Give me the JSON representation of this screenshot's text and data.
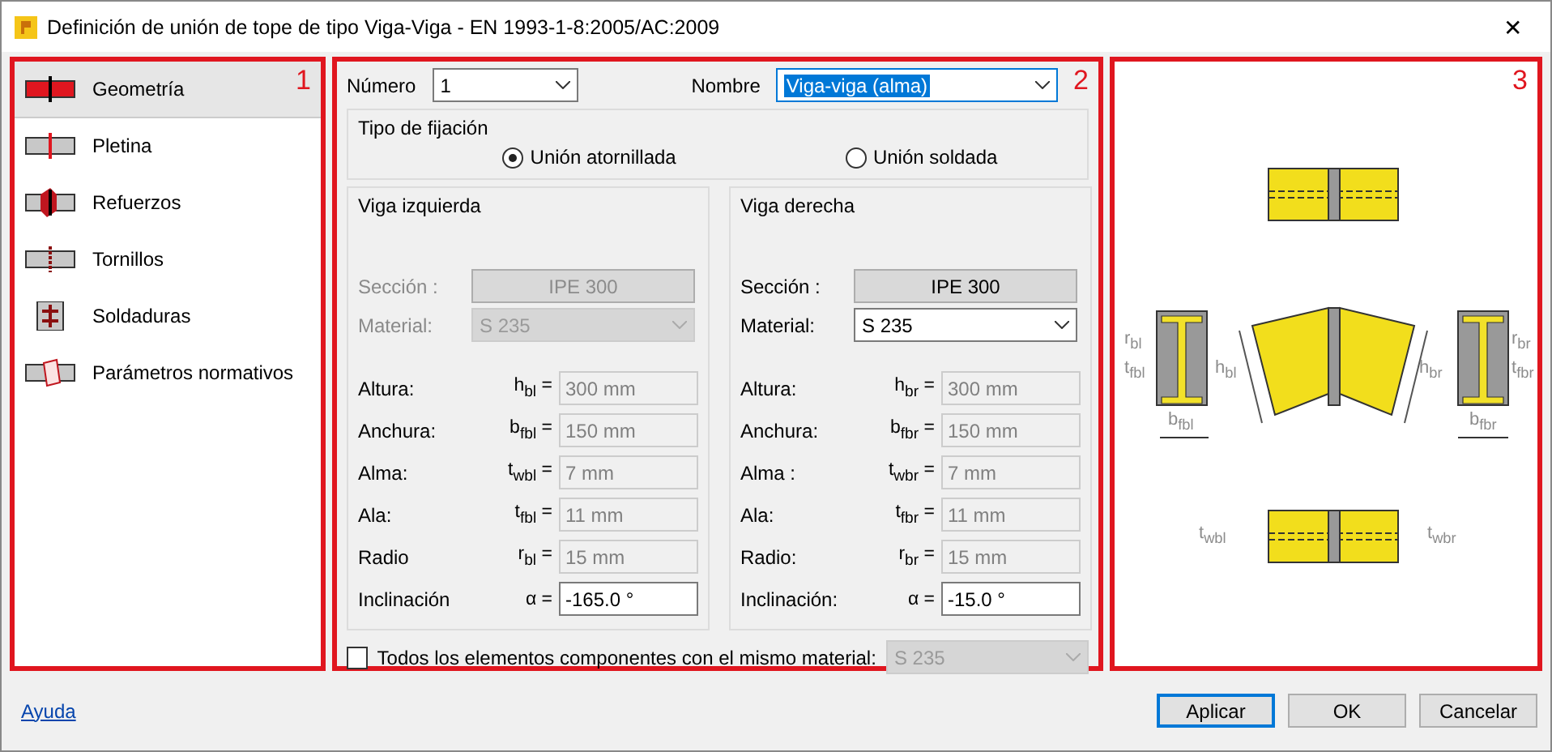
{
  "window": {
    "title": "Definición de unión de tope de tipo Viga-Viga - EN 1993-1-8:2005/AC:2009",
    "close": "✕"
  },
  "callouts": [
    "1",
    "2",
    "3"
  ],
  "sidebar": {
    "items": [
      {
        "label": "Geometría",
        "selected": true,
        "kind": "geometry"
      },
      {
        "label": "Pletina",
        "selected": false,
        "kind": "plate"
      },
      {
        "label": "Refuerzos",
        "selected": false,
        "kind": "stiffener"
      },
      {
        "label": "Tornillos",
        "selected": false,
        "kind": "bolts"
      },
      {
        "label": "Soldaduras",
        "selected": false,
        "kind": "welds"
      },
      {
        "label": "Parámetros normativos",
        "selected": false,
        "kind": "params"
      }
    ]
  },
  "header": {
    "number_label": "Número",
    "number_value": "1",
    "name_label": "Nombre",
    "name_value": "Viga-viga (alma)"
  },
  "fixing": {
    "title": "Tipo de fijación",
    "options": [
      {
        "label": "Unión atornillada",
        "selected": true
      },
      {
        "label": "Unión soldada",
        "selected": false
      }
    ]
  },
  "beams": [
    {
      "title": "Viga izquierda",
      "section_label": "Sección :",
      "section_value": "IPE 300",
      "material_label": "Material:",
      "material_value": "S 235",
      "disabled": true,
      "rows": [
        {
          "label": "Altura:",
          "symbol": "h$_{bl}$ =",
          "value": "300 mm",
          "disabled": true
        },
        {
          "label": "Anchura:",
          "symbol": "b$_{fbl}$ =",
          "value": "150 mm",
          "disabled": true
        },
        {
          "label": "Alma:",
          "symbol": "t$_{wbl}$ =",
          "value": "7 mm",
          "disabled": true
        },
        {
          "label": "Ala:",
          "symbol": "t$_{fbl}$ =",
          "value": "11 mm",
          "disabled": true
        },
        {
          "label": "Radio",
          "symbol": "r$_{bl}$ =",
          "value": "15 mm",
          "disabled": true
        },
        {
          "label": "Inclinación",
          "symbol": "α  =",
          "value": "-165.0 °",
          "disabled": false
        }
      ]
    },
    {
      "title": "Viga derecha",
      "section_label": "Sección :",
      "section_value": "IPE 300",
      "material_label": "Material:",
      "material_value": "S 235",
      "disabled": false,
      "rows": [
        {
          "label": "Altura:",
          "symbol": "h$_{br}$ =",
          "value": "300 mm",
          "disabled": true
        },
        {
          "label": "Anchura:",
          "symbol": "b$_{fbr}$ =",
          "value": "150 mm",
          "disabled": true
        },
        {
          "label": "Alma :",
          "symbol": "t$_{wbr}$ =",
          "value": "7 mm",
          "disabled": true
        },
        {
          "label": "Ala:",
          "symbol": "t$_{fbr}$ =",
          "value": "11 mm",
          "disabled": true
        },
        {
          "label": "Radio:",
          "symbol": "r$_{br}$ =",
          "value": "15 mm",
          "disabled": true
        },
        {
          "label": "Inclinación:",
          "symbol": "α  =",
          "value": "-15.0 °",
          "disabled": false
        }
      ]
    }
  ],
  "same_material": {
    "label": "Todos los elementos componentes con el mismo material:",
    "checked": false,
    "value": "S 235",
    "disabled": true
  },
  "diagram_labels": [
    "r$_{bl}$",
    "t$_{fbl}$",
    "b$_{fbl}$",
    "h$_{bl}$",
    "h$_{br}$",
    "r$_{br}$",
    "t$_{fbr}$",
    "b$_{fbr}$",
    "t$_{wbl}$",
    "t$_{wbr}$"
  ],
  "footer": {
    "help": "Ayuda",
    "buttons": [
      {
        "label": "Aplicar",
        "selected": true
      },
      {
        "label": "OK",
        "selected": false
      },
      {
        "label": "Cancelar",
        "selected": false
      }
    ]
  }
}
